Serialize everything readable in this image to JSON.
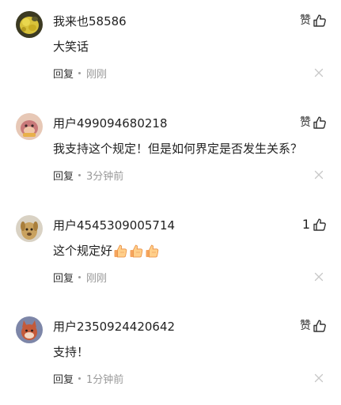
{
  "colors": {
    "text": "#222222",
    "secondary": "#999999",
    "icon": "#333333",
    "close_icon": "#c8c8c8"
  },
  "comments": [
    {
      "username": "我来也58586",
      "like_label": "赞",
      "like_count": "",
      "content": "大笑话",
      "reply_label": "回复",
      "time": "刚刚",
      "avatar_icon": "yellow-flower-avatar",
      "emojis": []
    },
    {
      "username": "用户499094680218",
      "like_label": "赞",
      "like_count": "",
      "content": "我支持这个规定！但是如何界定是否发生关系？",
      "reply_label": "回复",
      "time": "3分钟前",
      "avatar_icon": "cartoon-pig-avatar",
      "emojis": []
    },
    {
      "username": "用户4545309005714",
      "like_label": "",
      "like_count": "1",
      "content": "这个规定好",
      "reply_label": "回复",
      "time": "刚刚",
      "avatar_icon": "cartoon-dog-avatar",
      "emojis": [
        "thumbs-up-emoji",
        "thumbs-up-emoji",
        "thumbs-up-emoji"
      ]
    },
    {
      "username": "用户2350924420642",
      "like_label": "赞",
      "like_count": "",
      "content": "支持！",
      "reply_label": "回复",
      "time": "1分钟前",
      "avatar_icon": "cartoon-fox-avatar",
      "emojis": []
    }
  ]
}
